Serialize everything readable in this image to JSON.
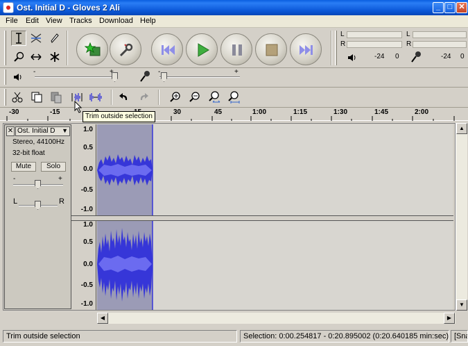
{
  "window": {
    "title": "Ost. Initial D - Gloves 2 Ali"
  },
  "menu": [
    "File",
    "Edit",
    "View",
    "Tracks",
    "Download",
    "Help"
  ],
  "meters": {
    "playback": {
      "left_label": "L",
      "right_label": "R",
      "db_labels": [
        "-24",
        "0"
      ]
    },
    "record": {
      "left_label": "L",
      "right_label": "R",
      "db_labels": [
        "-24",
        "0"
      ]
    }
  },
  "mixer": {
    "plus": "+",
    "minus": "-"
  },
  "ruler": {
    "labels": [
      "-30",
      "-15",
      "0",
      "15",
      "30",
      "45",
      "1:00",
      "1:15",
      "1:30",
      "1:45",
      "2:00"
    ]
  },
  "tooltip": "Trim outside selection",
  "track": {
    "name": "Ost. Initial D",
    "menu_arrow": "▼",
    "close": "✕",
    "format": "Stereo, 44100Hz",
    "bit_depth": "32-bit float",
    "mute_label": "Mute",
    "solo_label": "Solo",
    "gain_minus": "-",
    "gain_plus": "+",
    "pan_left": "L",
    "pan_right": "R",
    "y_labels": [
      "1.0",
      "0.5",
      "0.0",
      "-0.5",
      "-1.0"
    ]
  },
  "status": {
    "message": "Trim outside selection",
    "selection": "Selection: 0:00.254817 - 0:20.895002 (0:20.640185 min:sec)",
    "snap": "[Sna"
  },
  "colors": {
    "wave": "#3636d8",
    "wave_light": "#6b6bf0",
    "selection": "#9b9bb6",
    "title_bar": "#0a5fe0"
  }
}
